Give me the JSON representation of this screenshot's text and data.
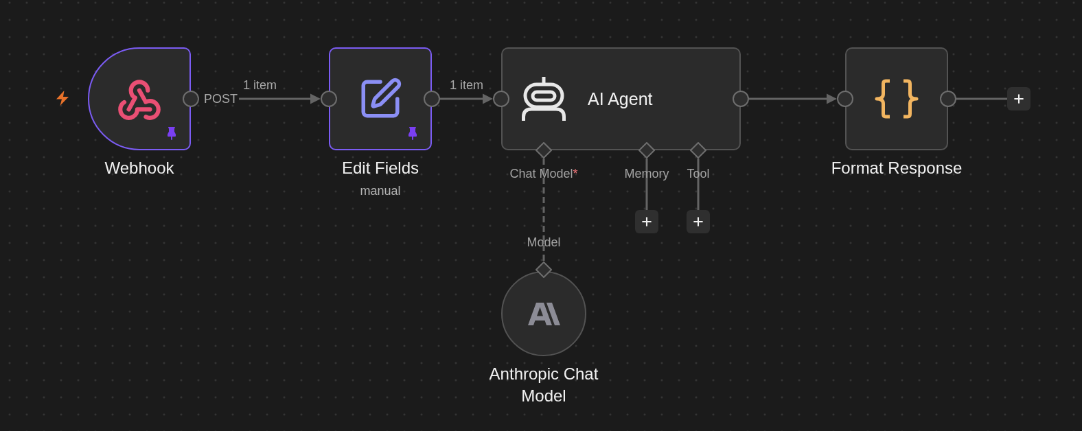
{
  "nodes": [
    {
      "kind": "webhook",
      "name": "Webhook",
      "trigger": true,
      "pinned": true,
      "output_label": "POST",
      "output_items": "1 item"
    },
    {
      "kind": "set",
      "name": "Edit Fields",
      "subtitle": "manual",
      "trigger": false,
      "pinned": true,
      "output_items": "1 item"
    },
    {
      "kind": "agent",
      "name": "AI Agent",
      "trigger": false,
      "pinned": false,
      "ports": [
        {
          "label": "Chat Model",
          "required_mark": "*",
          "sub_node": {
            "kind": "model",
            "name": "Anthropic Chat Model",
            "port_label": "Model"
          }
        },
        {
          "label": "Memory"
        },
        {
          "label": "Tool"
        }
      ]
    },
    {
      "kind": "code",
      "name": "Format Response",
      "trigger": false,
      "pinned": false
    }
  ]
}
